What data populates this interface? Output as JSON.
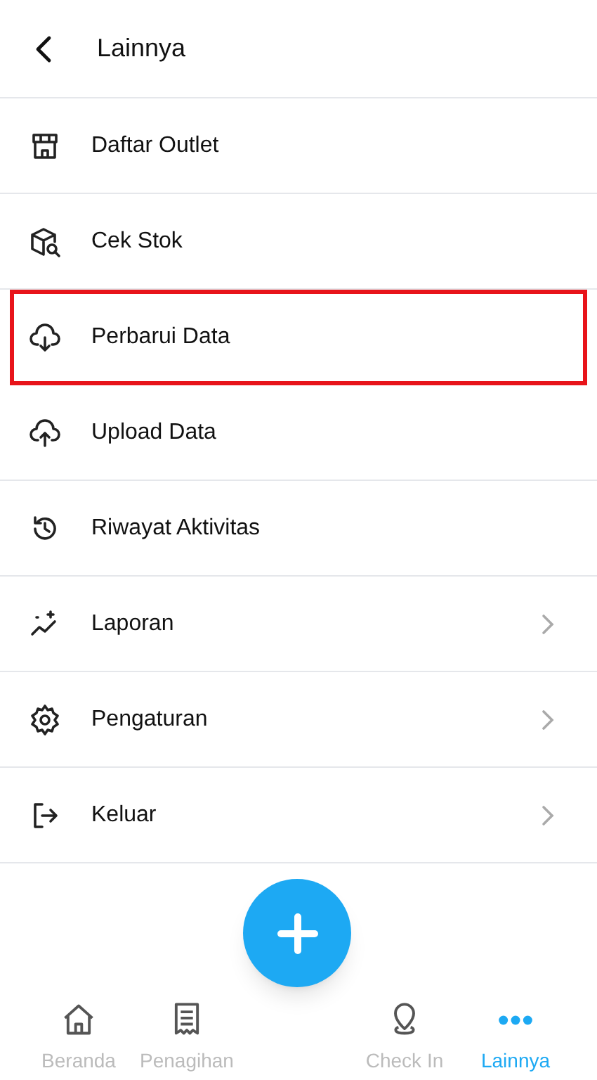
{
  "header": {
    "title": "Lainnya"
  },
  "menu": [
    {
      "label": "Daftar Outlet",
      "highlighted": false,
      "has_arrow": false
    },
    {
      "label": "Cek Stok",
      "highlighted": false,
      "has_arrow": false
    },
    {
      "label": "Perbarui Data",
      "highlighted": true,
      "has_arrow": false
    },
    {
      "label": "Upload Data",
      "highlighted": false,
      "has_arrow": false
    },
    {
      "label": "Riwayat Aktivitas",
      "highlighted": false,
      "has_arrow": false
    },
    {
      "label": "Laporan",
      "highlighted": false,
      "has_arrow": true
    },
    {
      "label": "Pengaturan",
      "highlighted": false,
      "has_arrow": true
    },
    {
      "label": "Keluar",
      "highlighted": false,
      "has_arrow": true
    }
  ],
  "bottom_nav": [
    {
      "label": "Beranda",
      "selected": false
    },
    {
      "label": "Penagihan",
      "selected": false
    },
    {
      "label": "Check In",
      "selected": false
    },
    {
      "label": "Lainnya",
      "selected": true
    }
  ]
}
